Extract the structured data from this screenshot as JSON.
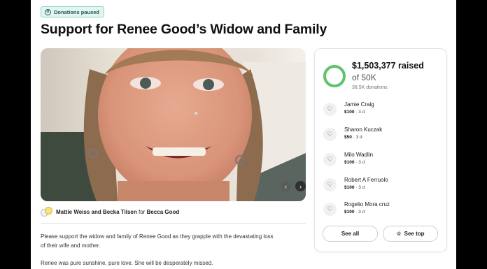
{
  "status_badge": {
    "icon": "clock-icon",
    "label": "Donations paused"
  },
  "title": "Support for Renee Good’s Widow and Family",
  "gallery": {
    "prev_icon": "chevron-left-icon",
    "next_icon": "chevron-right-icon"
  },
  "organizer": {
    "names": "Mattie Weiss and Becka Tilsen",
    "for_word": "for",
    "beneficiary": "Becca Good"
  },
  "story": {
    "paragraph_1": "Please support the widow and family of Renee Good as they grapple with the devastating loss of their wife and mother.",
    "paragraph_2": "Renee was pure sunshine, pure love. She will be desperately missed."
  },
  "fundraiser": {
    "raised": "$1,503,377 raised",
    "goal": "of 50K",
    "donation_count": "38.5K donations",
    "progress_fraction": 1.0,
    "accent_color": "#62c46a",
    "donations": [
      {
        "name": "Jamie Craig",
        "amount": "$100",
        "time": "3 d"
      },
      {
        "name": "Sharon Kuczak",
        "amount": "$50",
        "time": "3 d"
      },
      {
        "name": "Milo Wadlin",
        "amount": "$100",
        "time": "3 d"
      },
      {
        "name": "Robert A Ferruolo",
        "amount": "$100",
        "time": "3 d"
      },
      {
        "name": "Rogelio Mora cruz",
        "amount": "$100",
        "time": "3 d"
      }
    ],
    "separator": " · ",
    "see_all_label": "See all",
    "see_top_label": "See top"
  }
}
